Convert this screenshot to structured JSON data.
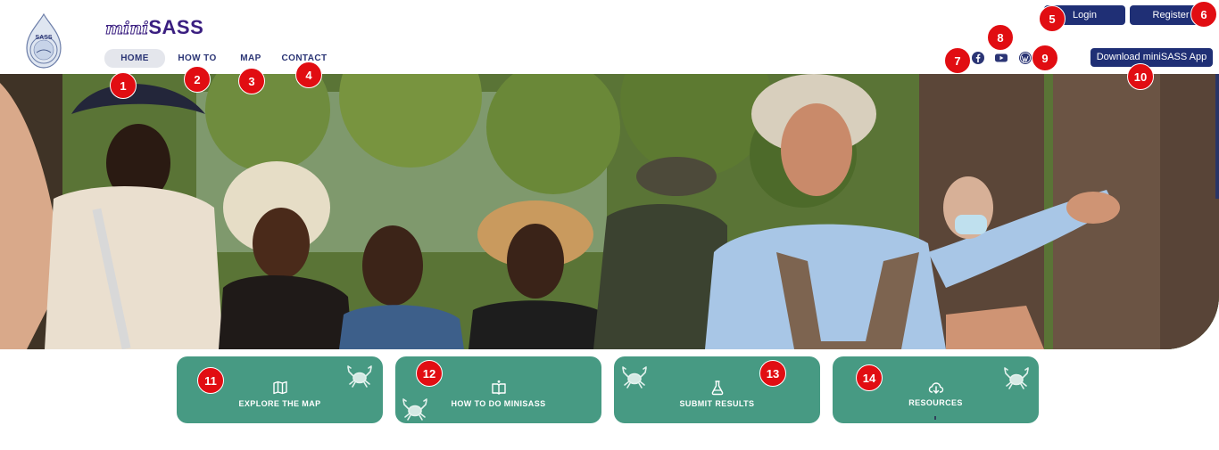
{
  "header": {
    "brand_prefix": "mini",
    "brand_name": "SASS",
    "logo_text": "SASS"
  },
  "nav": {
    "items": [
      {
        "label": "HOME",
        "active": true
      },
      {
        "label": "HOW TO"
      },
      {
        "label": "MAP"
      },
      {
        "label": "CONTACT US"
      }
    ]
  },
  "account": {
    "login_label": "Login",
    "register_label": "Register"
  },
  "social": {
    "icons": [
      "facebook-icon",
      "youtube-icon",
      "wordpress-icon"
    ]
  },
  "download": {
    "label": "Download miniSASS App"
  },
  "cards": [
    {
      "label": "EXPLORE THE MAP",
      "icon": "map-icon"
    },
    {
      "label": "HOW TO DO MINISASS",
      "icon": "book-icon"
    },
    {
      "label": "SUBMIT RESULTS",
      "icon": "flask-icon"
    },
    {
      "label": "RESOURCES",
      "icon": "cloud-download-icon"
    }
  ],
  "markers": [
    "1",
    "2",
    "3",
    "4",
    "5",
    "6",
    "7",
    "8",
    "9",
    "10",
    "11",
    "12",
    "13",
    "14"
  ],
  "colors": {
    "brand": "#3a1e80",
    "nav_text": "#2b3575",
    "button": "#1f2f75",
    "card": "#479a83",
    "marker": "#e10d12"
  }
}
